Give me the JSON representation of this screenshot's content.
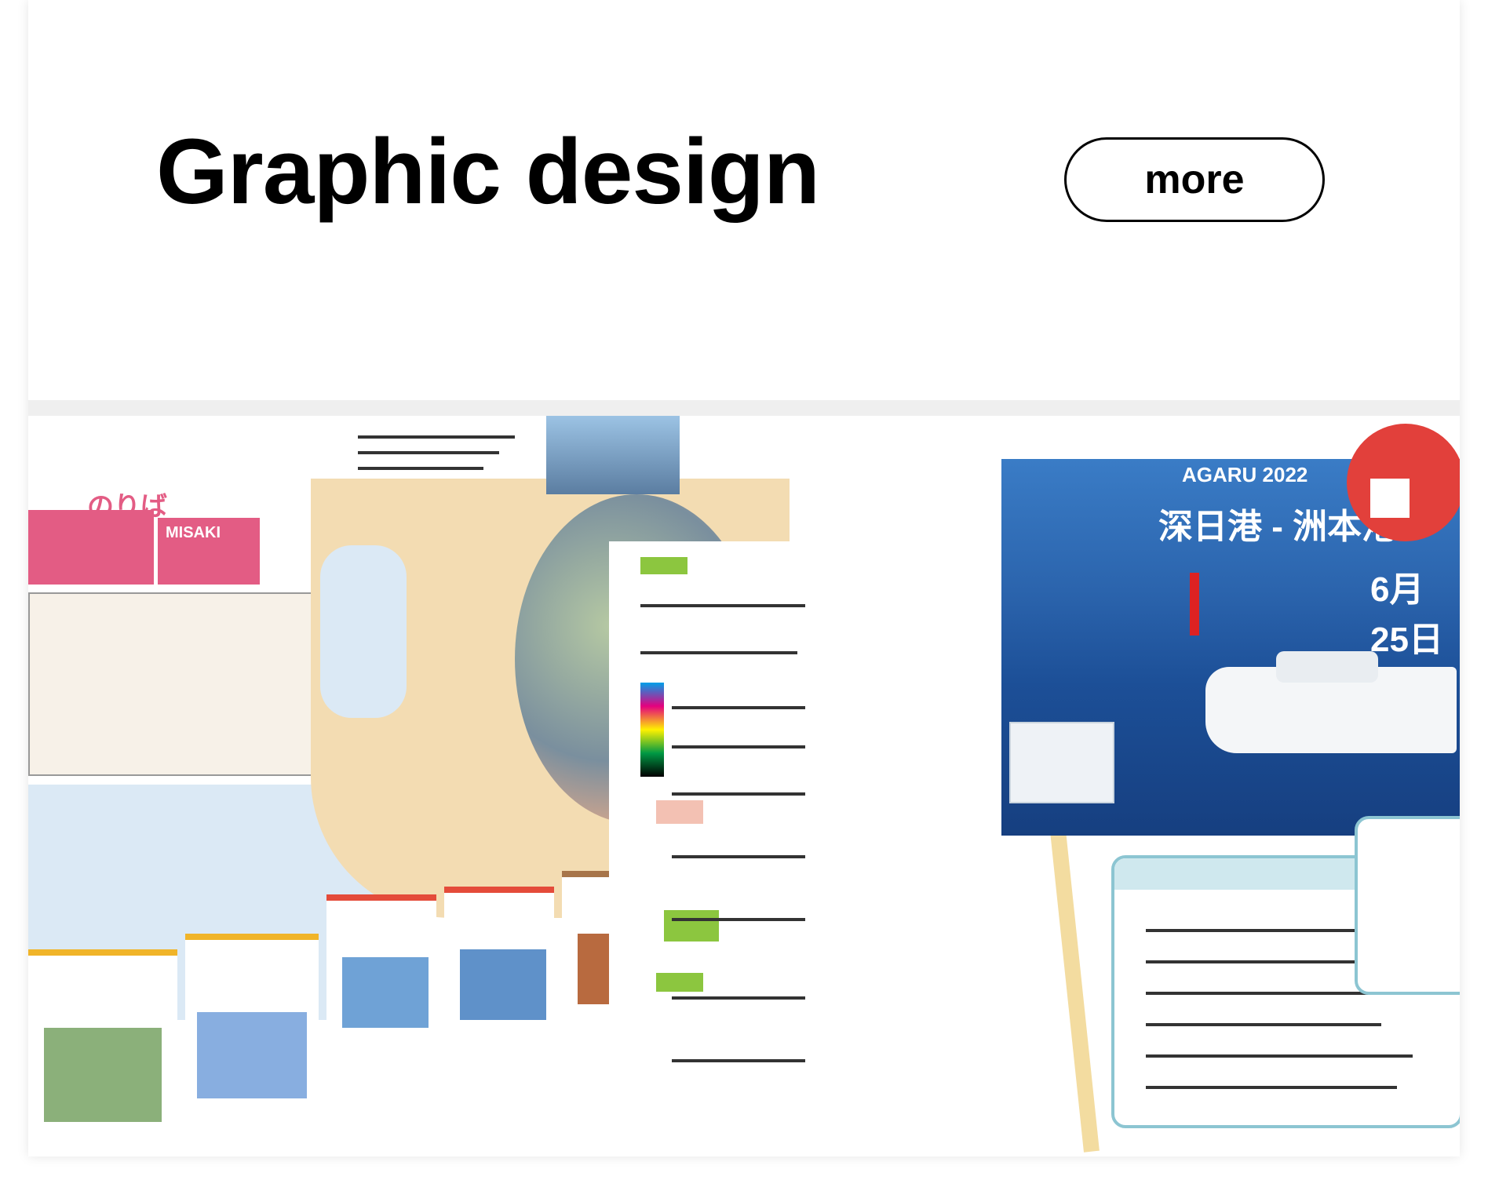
{
  "header": {
    "title": "Graphic design",
    "more_label": "more"
  },
  "thumbnail": {
    "left_spread": {
      "banner_text": "のりば",
      "tag_left": "MISAKI"
    },
    "right_spread": {
      "panel_heading": "AGARU 2022",
      "panel_title": "深日港 - 洲本港",
      "date": "6月25日"
    }
  },
  "colors": {
    "pink": "#e35c84",
    "blue": "#2b64ad",
    "red": "#e2403b",
    "sand": "#f3dcb2"
  }
}
